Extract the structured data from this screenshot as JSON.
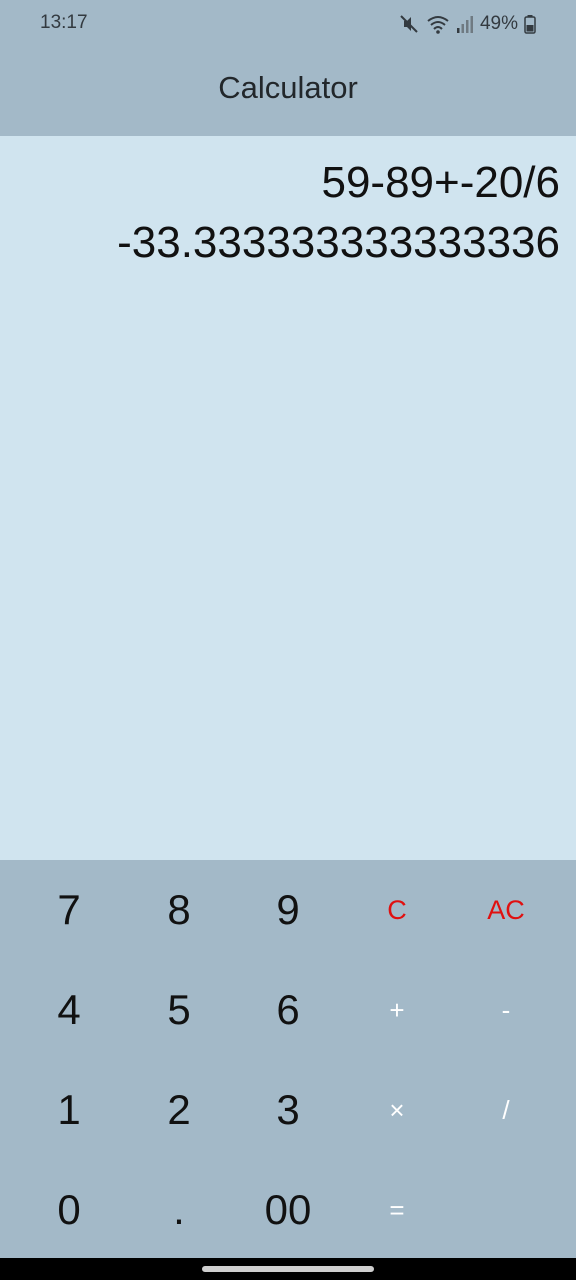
{
  "status_bar": {
    "time": "13:17",
    "battery": "49%",
    "icons": [
      "mute-icon",
      "wifi-icon",
      "signal-icon",
      "battery-icon"
    ]
  },
  "app": {
    "title": "Calculator"
  },
  "display": {
    "expression": "59-89+-20/6",
    "result": "-33.333333333333336"
  },
  "keypad": {
    "row1": [
      "7",
      "8",
      "9",
      "C",
      "AC"
    ],
    "row2": [
      "4",
      "5",
      "6",
      "+",
      "-"
    ],
    "row3": [
      "1",
      "2",
      "3",
      "×",
      "/"
    ],
    "row4": [
      "0",
      ".",
      "00",
      "="
    ]
  },
  "colors": {
    "bar_background": "#a3b9c8",
    "display_background": "#d0e4ef",
    "clear_keys": "#e01010",
    "operator_keys": "#ffffff"
  }
}
